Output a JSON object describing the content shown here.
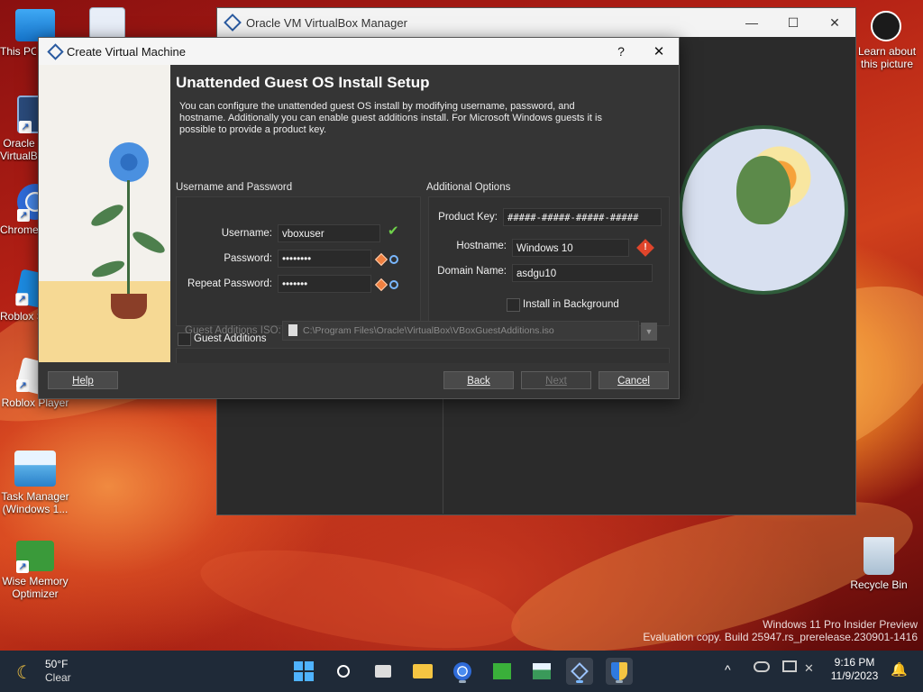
{
  "desktop": {
    "icons": [
      {
        "label": "This PC"
      },
      {
        "label": ""
      },
      {
        "label": "Oracle VirtualBox"
      },
      {
        "label": "Chrome"
      },
      {
        "label": "Roblox Studio"
      },
      {
        "label": "Roblox Player"
      },
      {
        "label": "Task Manager (Windows 1..."
      },
      {
        "label": "Wise Memory Optimizer"
      },
      {
        "label": "Recycle Bin"
      },
      {
        "label": "Learn about this picture"
      }
    ],
    "watermark": {
      "line1": "Windows 11 Pro Insider Preview",
      "line2": "Evaluation copy. Build 25947.rs_prerelease.230901-1416"
    }
  },
  "manager": {
    "title": "Oracle VM VirtualBox Manager",
    "minimize": "—",
    "maximize": "☐",
    "close": "✕"
  },
  "dialog": {
    "title": "Create Virtual Machine",
    "help_q": "?",
    "close": "✕",
    "heading": "Unattended Guest OS Install Setup",
    "description": "You can configure the unattended guest OS install by modifying username, password, and hostname. Additionally you can enable guest additions install. For Microsoft Windows guests it is possible to provide a product key.",
    "credentials": {
      "group_label": "Username and Password",
      "username_label": "Username:",
      "username_value": "vboxuser",
      "password_label": "Password:",
      "password_value": "••••••••",
      "repeat_label": "Repeat Password:",
      "repeat_value": "•••••••"
    },
    "options": {
      "group_label": "Additional Options",
      "product_key_label": "Product Key:",
      "product_key_value": "#####-#####-#####-#####",
      "hostname_label": "Hostname:",
      "hostname_value": "Windows 10",
      "domain_label": "Domain Name:",
      "domain_value": "asdgu10",
      "install_bg_label": "Install in Background"
    },
    "guest_additions": {
      "label": "Guest Additions",
      "iso_label": "Guest Additions ISO:",
      "iso_value": "C:\\Program Files\\Oracle\\VirtualBox\\VBoxGuestAdditions.iso"
    },
    "buttons": {
      "help": "Help",
      "back": "Back",
      "next": "Next",
      "cancel": "Cancel"
    }
  },
  "taskbar": {
    "weather_temp": "50°F",
    "weather_desc": "Clear",
    "time": "9:16 PM",
    "date": "11/9/2023"
  },
  "colors": {
    "dialog_bg": "#353535",
    "accent_warning": "#e0452b",
    "accent_ok": "#6fd24a"
  }
}
